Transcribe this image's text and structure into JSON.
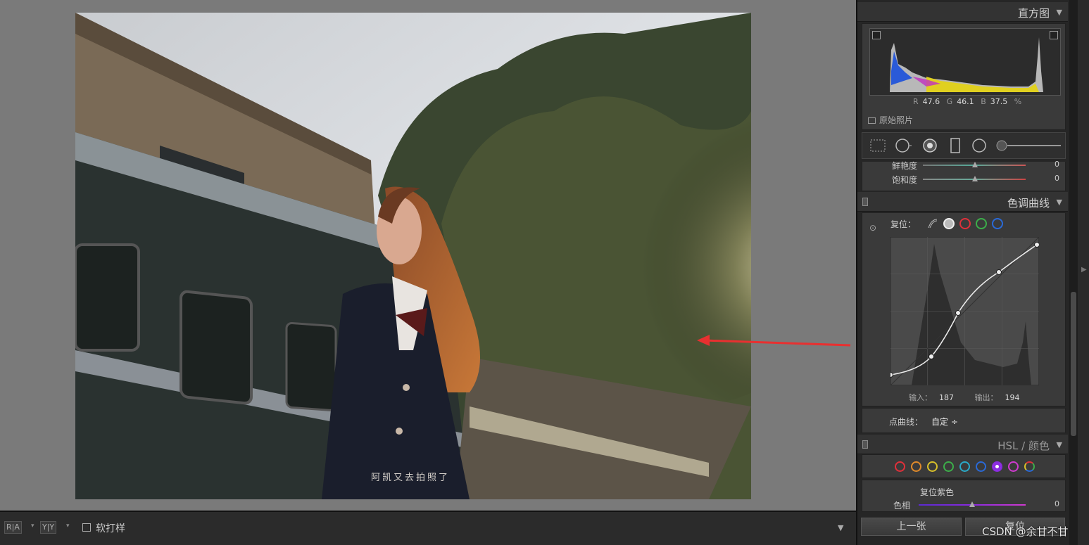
{
  "photo": {
    "caption": "阿凯又去拍照了"
  },
  "toolbar": {
    "view_btn_1": "R|A",
    "view_btn_2": "Y|Y",
    "softproof_label": "软打样"
  },
  "histogram": {
    "title": "直方图",
    "r_label": "R",
    "r_value": "47.6",
    "g_label": "G",
    "g_value": "46.1",
    "b_label": "B",
    "b_value": "37.5",
    "percent": "%",
    "original_photo_label": "原始照片"
  },
  "basic": {
    "vibrance_label": "鲜艳度",
    "vibrance_value": "0",
    "saturation_label": "饱和度",
    "saturation_value": "0"
  },
  "tone_curve": {
    "title": "色调曲线",
    "reset_label": "复位：",
    "input_label": "输入：",
    "input_value": "187",
    "output_label": "输出：",
    "output_value": "194",
    "point_curve_label": "点曲线：",
    "point_curve_value": "自定 ÷",
    "channels": [
      "parametric",
      "rgb",
      "red",
      "green",
      "blue"
    ]
  },
  "hsl": {
    "title": "HSL / 颜色",
    "reset_purple_label": "复位紫色",
    "hue_label": "色相",
    "hue_value": "0",
    "colors": [
      "#e0303a",
      "#e08a2a",
      "#d8c02a",
      "#3cae4a",
      "#2aaac8",
      "#2a6ad8",
      "#8a2ae0",
      "#d03ad0"
    ]
  },
  "nav": {
    "prev_label": "上一张",
    "reset_label": "复位"
  },
  "watermark": "CSDN @余甘不甘",
  "colors": {
    "accent_red_arrow": "#e83030",
    "panel_bg": "#3a3a3a"
  }
}
